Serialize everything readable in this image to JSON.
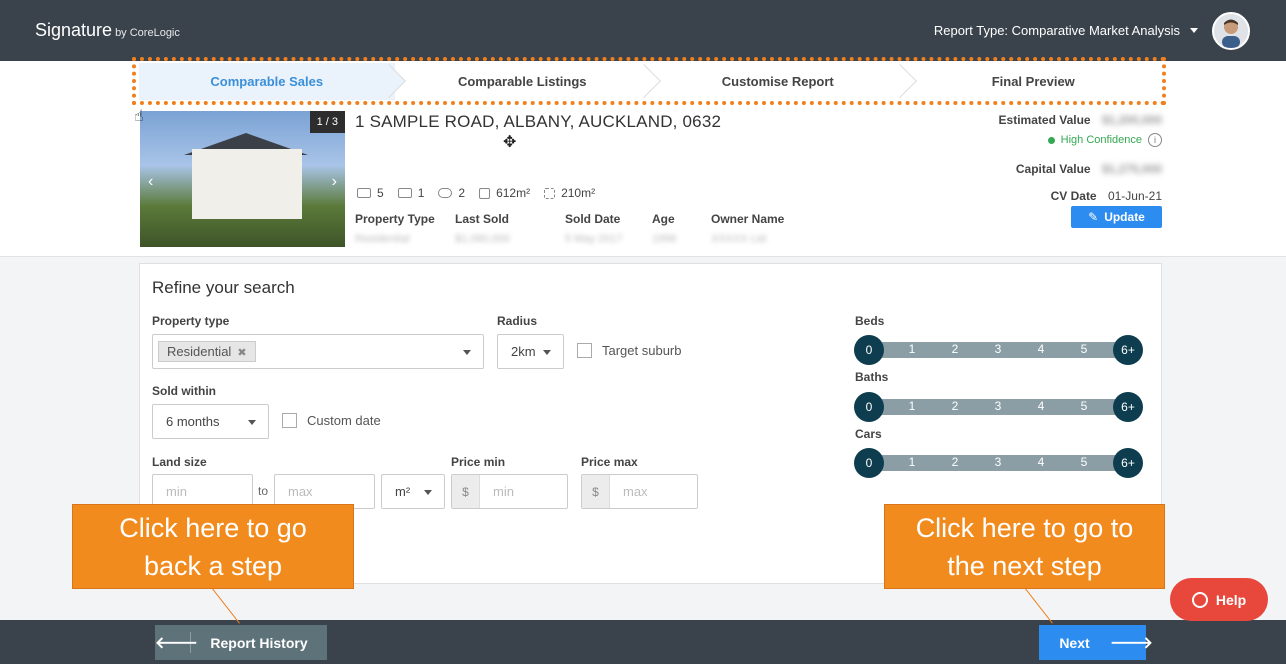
{
  "header": {
    "brand": "Signature",
    "brand_sub": "by CoreLogic",
    "report_type": "Report Type: Comparative Market Analysis"
  },
  "steps": [
    {
      "label": "Comparable Sales",
      "active": true
    },
    {
      "label": "Comparable Listings",
      "active": false
    },
    {
      "label": "Customise Report",
      "active": false
    },
    {
      "label": "Final Preview",
      "active": false
    }
  ],
  "property": {
    "photo_count": "1 / 3",
    "address": "1 SAMPLE ROAD, ALBANY, AUCKLAND, 0632",
    "features": {
      "beds": "5",
      "baths": "1",
      "cars": "2",
      "land": "612m²",
      "floor": "210m²"
    },
    "meta_labels": [
      "Property Type",
      "Last Sold",
      "Sold Date",
      "Age",
      "Owner Name"
    ],
    "meta_values": [
      "Residential",
      "$1,080,000",
      "5 May 2017",
      "1996",
      "XXXXX Ltd"
    ]
  },
  "valuation": {
    "estimated_label": "Estimated Value",
    "estimated_value": "$1,200,000",
    "confidence": "High Confidence",
    "capital_label": "Capital Value",
    "capital_value": "$1,275,000",
    "cv_date_label": "CV Date",
    "cv_date": "01-Jun-21",
    "update_label": "Update"
  },
  "refine": {
    "title": "Refine your search",
    "property_type_label": "Property type",
    "property_type_tag": "Residential",
    "radius_label": "Radius",
    "radius_value": "2km",
    "target_suburb_label": "Target suburb",
    "sold_within_label": "Sold within",
    "sold_within_value": "6 months",
    "custom_date_label": "Custom date",
    "land_size_label": "Land size",
    "land_min_placeholder": "min",
    "land_to": "to",
    "land_max_placeholder": "max",
    "land_unit": "m²",
    "price_min_label": "Price min",
    "price_max_label": "Price max",
    "currency": "$",
    "price_min_placeholder": "min",
    "price_max_placeholder": "max",
    "counters": [
      {
        "label": "Beds",
        "values": [
          "0",
          "1",
          "2",
          "3",
          "4",
          "5",
          "6+"
        ]
      },
      {
        "label": "Baths",
        "values": [
          "0",
          "1",
          "2",
          "3",
          "4",
          "5",
          "6+"
        ]
      },
      {
        "label": "Cars",
        "values": [
          "0",
          "1",
          "2",
          "3",
          "4",
          "5",
          "6+"
        ]
      }
    ]
  },
  "footer": {
    "back_label": "Report History",
    "next_label": "Next",
    "help_label": "Help"
  },
  "callouts": {
    "back": "Click here to go back a step",
    "next": "Click here to go to the next step"
  },
  "colors": {
    "accent": "#2d8cf0",
    "callout": "#f28b1e",
    "header": "#3a434c",
    "help": "#e8473c",
    "counter_knob": "#0e3d4f"
  }
}
